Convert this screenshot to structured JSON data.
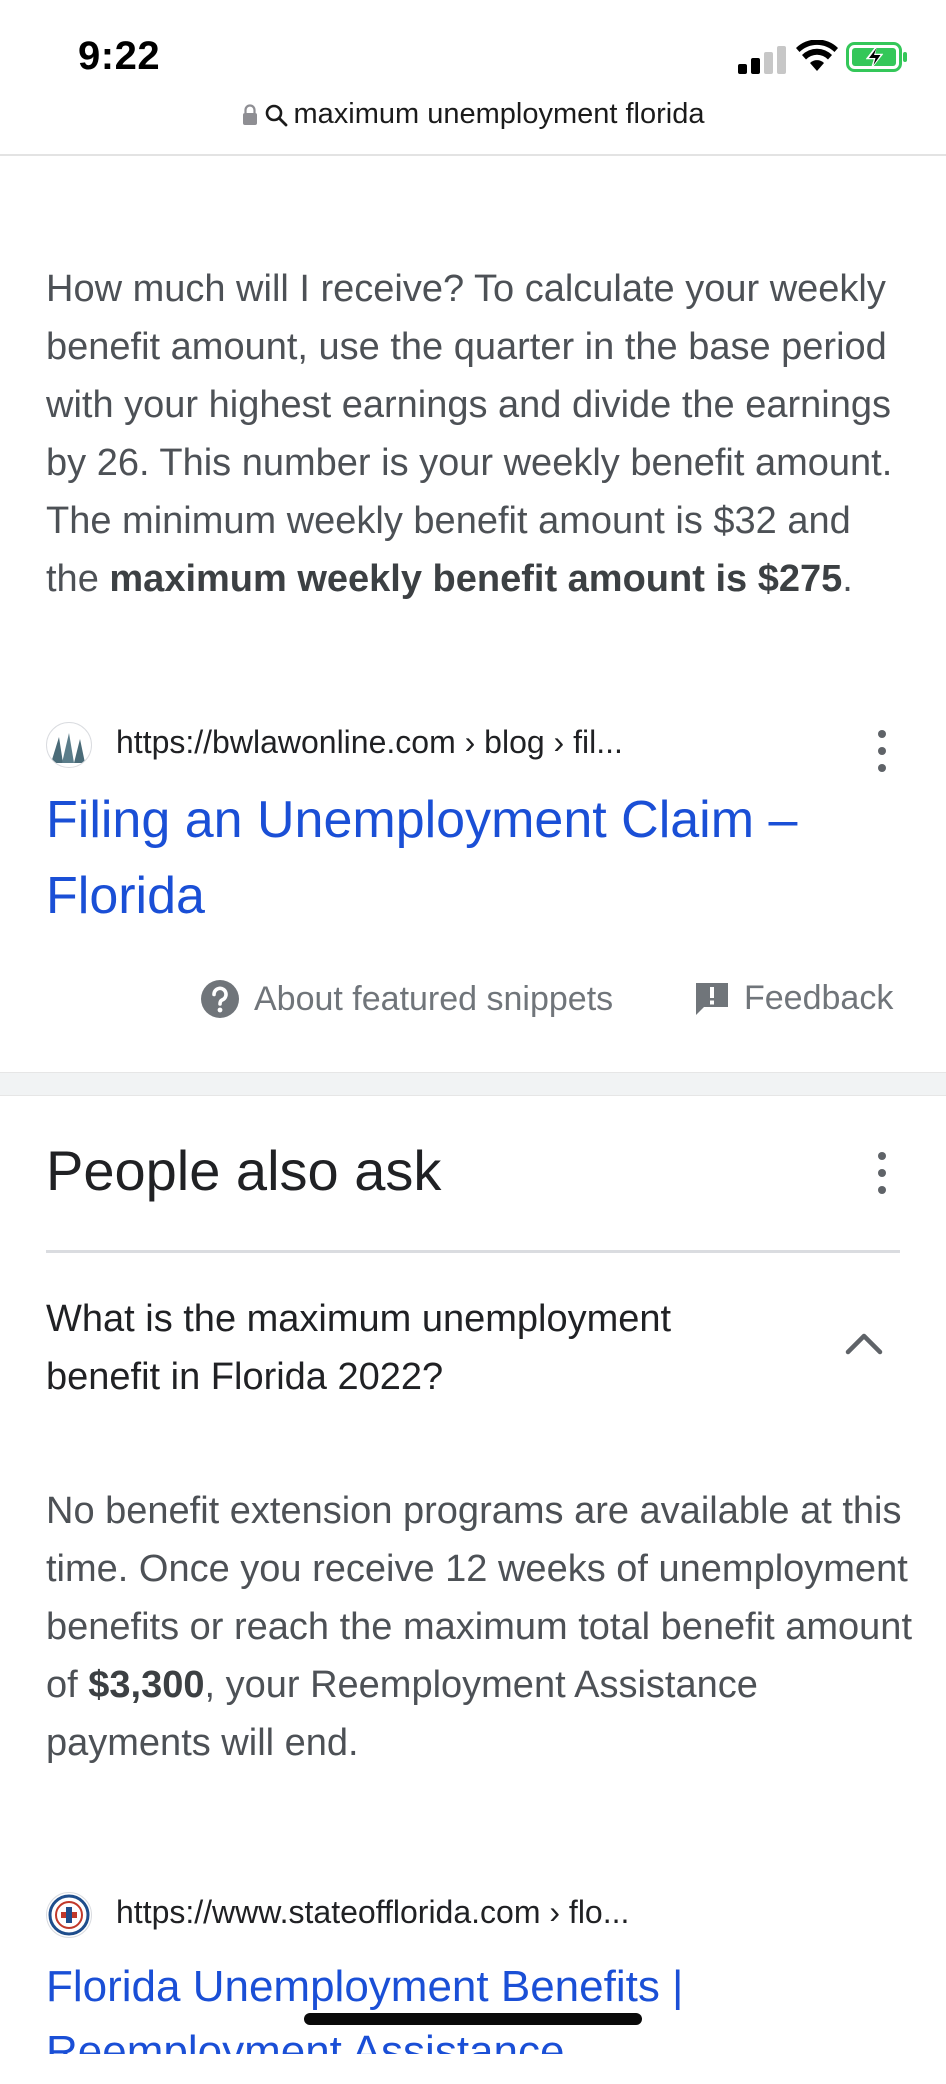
{
  "status_bar": {
    "time": "9:22",
    "signal_icon": "cellular-signal-icon",
    "wifi_icon": "wifi-icon",
    "battery_icon": "battery-charging-icon",
    "battery_color": "#34c759"
  },
  "address_bar": {
    "lock_icon": "lock-icon",
    "search_icon": "search-icon",
    "query": "maximum unemployment florida"
  },
  "featured_snippet": {
    "text_plain": "How much will I receive? To calculate your weekly benefit amount, use the quarter in the base period with your highest earnings and divide the earnings by 26. This number is your weekly benefit amount. The minimum weekly benefit amount is $32 and the ",
    "text_bold": "maximum weekly benefit amount is $275",
    "text_end": ".",
    "source_url": "https://bwlawonline.com › blog › fil...",
    "result_title": "Filing an Unemployment Claim – Florida",
    "about_label": "About featured snippets",
    "feedback_label": "Feedback",
    "link_color": "#1a4fd6"
  },
  "people_also_ask": {
    "title": "People also ask",
    "question": "What is the maximum unemployment benefit in Florida 2022?",
    "answer_plain": "No benefit extension programs are available at this time. Once you receive 12 weeks of unemployment benefits or reach the maximum total benefit amount of ",
    "answer_bold": "$3,300",
    "answer_end": ", your Reemployment Assistance payments will end.",
    "source_url": "https://www.stateofflorida.com › flo...",
    "result_title": "Florida Unemployment Benefits |",
    "result_title_cont": "Reemployment Assistance"
  }
}
